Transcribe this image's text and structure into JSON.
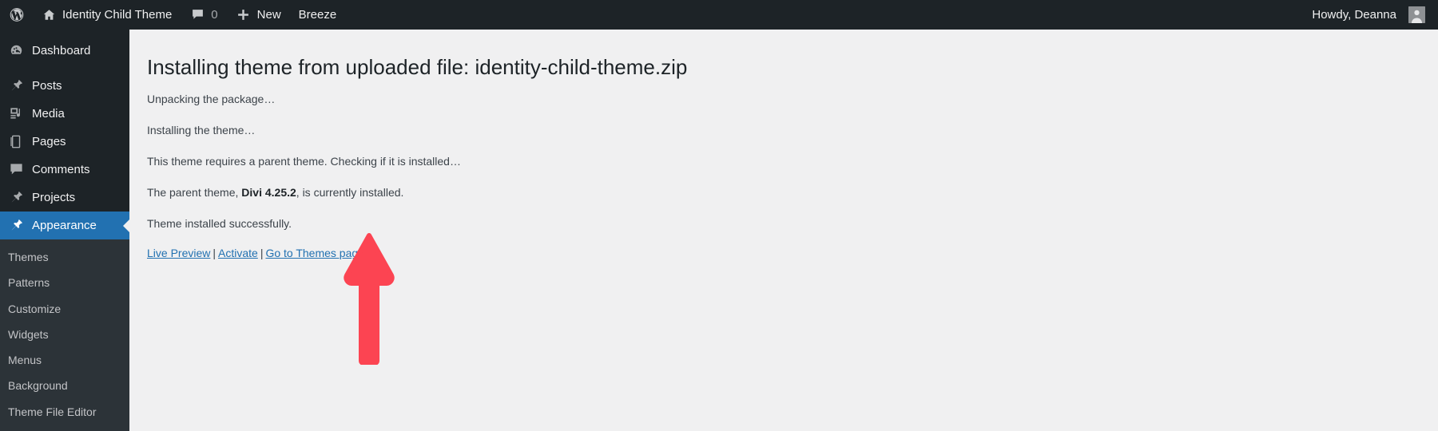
{
  "adminbar": {
    "logo_icon": "wordpress-logo-icon",
    "site": {
      "icon": "home-icon",
      "label": "Identity Child Theme"
    },
    "comments": {
      "icon": "comment-bubble-icon",
      "count": "0"
    },
    "new": {
      "icon": "plus-icon",
      "label": "New"
    },
    "breeze": {
      "label": "Breeze"
    },
    "howdy": {
      "label": "Howdy, Deanna",
      "avatar_icon": "user-avatar-icon"
    }
  },
  "sidebar": {
    "items": [
      {
        "label": "Dashboard",
        "icon": "dashboard-gauge-icon",
        "active": false
      },
      {
        "label": "Posts",
        "icon": "pin-icon",
        "active": false
      },
      {
        "label": "Media",
        "icon": "media-music-icon",
        "active": false
      },
      {
        "label": "Pages",
        "icon": "pages-icon",
        "active": false
      },
      {
        "label": "Comments",
        "icon": "comment-bubble-icon",
        "active": false
      },
      {
        "label": "Projects",
        "icon": "pin-icon",
        "active": false
      },
      {
        "label": "Appearance",
        "icon": "paintbrush-icon",
        "active": true
      }
    ],
    "submenu": [
      {
        "label": "Themes"
      },
      {
        "label": "Patterns"
      },
      {
        "label": "Customize"
      },
      {
        "label": "Widgets"
      },
      {
        "label": "Menus"
      },
      {
        "label": "Background"
      },
      {
        "label": "Theme File Editor"
      }
    ]
  },
  "main": {
    "title": "Installing theme from uploaded file: identity-child-theme.zip",
    "log": [
      {
        "text": "Unpacking the package…"
      },
      {
        "text": "Installing the theme…"
      },
      {
        "text": "This theme requires a parent theme. Checking if it is installed…"
      },
      {
        "prefix": "The parent theme, ",
        "strong": "Divi 4.25.2",
        "suffix": ", is currently installed."
      },
      {
        "text": "Theme installed successfully."
      }
    ],
    "links": {
      "live_preview": "Live Preview",
      "activate": "Activate",
      "themes_page": "Go to Themes page",
      "separator": "|"
    }
  },
  "annotation": {
    "arrow_icon": "red-up-arrow-icon",
    "color": "#fc4452",
    "points_to": "Activate"
  },
  "colors": {
    "admin_dark": "#1d2327",
    "submenu_dark": "#2c3338",
    "accent_blue": "#2271b1",
    "link_blue": "#2271b1",
    "content_bg": "#f0f0f1",
    "annotation_red": "#fc4452"
  }
}
